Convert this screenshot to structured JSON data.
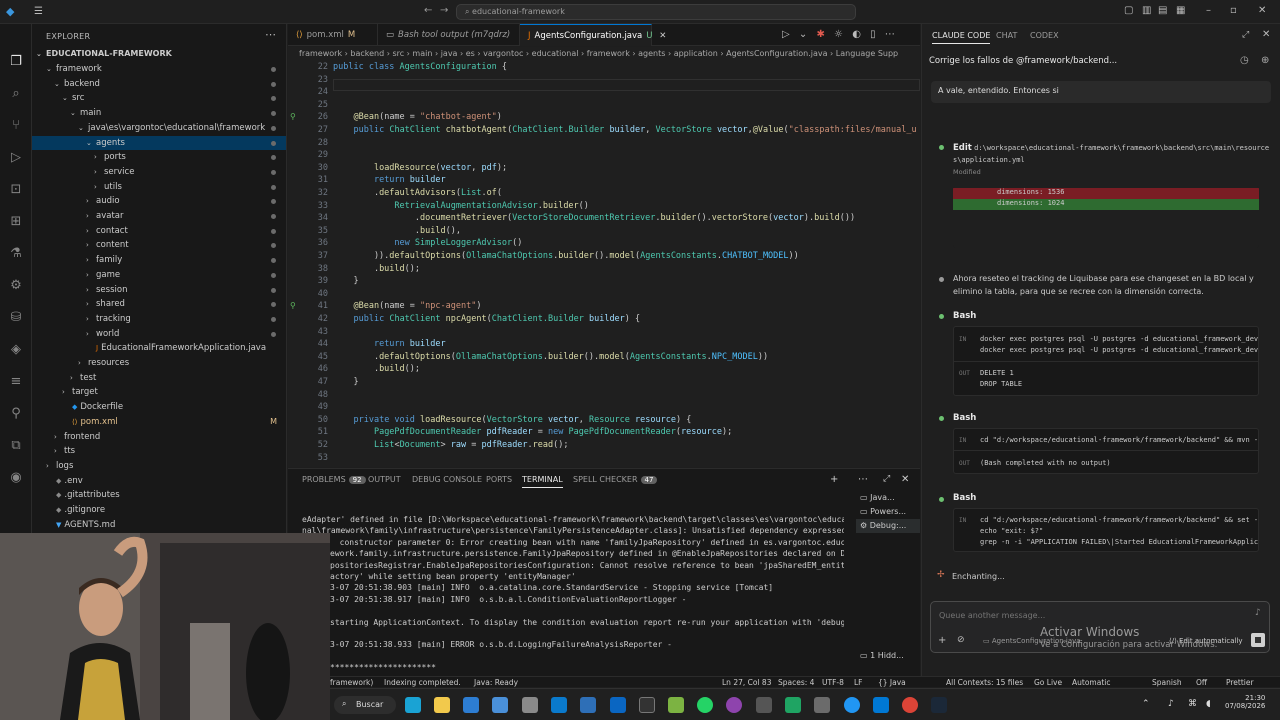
{
  "titlebar": {
    "search": "educational-framework",
    "menu_glyph": "☰"
  },
  "explorer": {
    "header": "EXPLORER",
    "root": "EDUCATIONAL-FRAMEWORK",
    "items": [
      {
        "label": "framework",
        "depth": 1,
        "type": "folder-open"
      },
      {
        "label": "backend",
        "depth": 2,
        "type": "folder-open"
      },
      {
        "label": "src",
        "depth": 3,
        "type": "folder-open"
      },
      {
        "label": "main",
        "depth": 4,
        "type": "folder-open"
      },
      {
        "label": "java\\es\\vargontoc\\educational\\framework",
        "depth": 5,
        "type": "folder-open"
      },
      {
        "label": "agents",
        "depth": 6,
        "type": "folder-open"
      },
      {
        "label": "ports",
        "depth": 7,
        "type": "folder"
      },
      {
        "label": "service",
        "depth": 7,
        "type": "folder"
      },
      {
        "label": "utils",
        "depth": 7,
        "type": "folder"
      },
      {
        "label": "audio",
        "depth": 6,
        "type": "folder"
      },
      {
        "label": "avatar",
        "depth": 6,
        "type": "folder"
      },
      {
        "label": "contact",
        "depth": 6,
        "type": "folder"
      },
      {
        "label": "content",
        "depth": 6,
        "type": "folder"
      },
      {
        "label": "family",
        "depth": 6,
        "type": "folder"
      },
      {
        "label": "game",
        "depth": 6,
        "type": "folder"
      },
      {
        "label": "session",
        "depth": 6,
        "type": "folder"
      },
      {
        "label": "shared",
        "depth": 6,
        "type": "folder"
      },
      {
        "label": "tracking",
        "depth": 6,
        "type": "folder"
      },
      {
        "label": "world",
        "depth": 6,
        "type": "folder"
      },
      {
        "label": "EducationalFrameworkApplication.java",
        "depth": 6,
        "type": "file"
      },
      {
        "label": "resources",
        "depth": 5,
        "type": "folder"
      },
      {
        "label": "test",
        "depth": 4,
        "type": "folder"
      },
      {
        "label": "target",
        "depth": 3,
        "type": "folder"
      },
      {
        "label": "Dockerfile",
        "depth": 3,
        "type": "file"
      },
      {
        "label": "pom.xml",
        "depth": 3,
        "type": "file",
        "flag": "M"
      },
      {
        "label": "frontend",
        "depth": 2,
        "type": "folder"
      },
      {
        "label": "tts",
        "depth": 2,
        "type": "folder"
      },
      {
        "label": "logs",
        "depth": 1,
        "type": "folder"
      },
      {
        "label": ".env",
        "depth": 1,
        "type": "file"
      },
      {
        "label": ".gitattributes",
        "depth": 1,
        "type": "file"
      },
      {
        "label": ".gitignore",
        "depth": 1,
        "type": "file"
      },
      {
        "label": "AGENTS.md",
        "depth": 1,
        "type": "file"
      },
      {
        "label": "docker-compose.yml",
        "depth": 1,
        "type": "file"
      }
    ]
  },
  "tabs": [
    {
      "label": "pom.xml",
      "flag": "M",
      "active": false
    },
    {
      "label": "Bash tool output (m7qdrz)",
      "flag": "",
      "active": false
    },
    {
      "label": "AgentsConfiguration.java",
      "flag": "U",
      "active": true
    }
  ],
  "breadcrumb": "framework › backend › src › main › java › es › vargontoc › educational › framework › agents › application › AgentsConfiguration.java › Language Supp",
  "code": {
    "lines": [
      {
        "n": "22",
        "html": "<span class='k'>public class</span> <span class='t'>AgentsConfiguration</span> {"
      },
      {
        "n": "23",
        "html": ""
      },
      {
        "n": "24",
        "html": ""
      },
      {
        "n": "25",
        "html": ""
      },
      {
        "n": "26",
        "html": "    <span class='a'>@Bean</span>(name = <span class='s'>\"chatbot-agent\"</span>)"
      },
      {
        "n": "27",
        "html": "    <span class='k'>public</span> <span class='t'>ChatClient</span> <span class='f'>chatbotAgent</span>(<span class='t'>ChatClient.Builder</span> <span class='p'>builder</span>, <span class='t'>VectorStore</span> <span class='p'>vector</span>,<span class='a'>@Value</span>(<span class='s'>\"classpath:files/manual_u</span>"
      },
      {
        "n": "28",
        "html": ""
      },
      {
        "n": "29",
        "html": ""
      },
      {
        "n": "30",
        "html": "        <span class='f'>loadResource</span>(<span class='p'>vector</span>, <span class='p'>pdf</span>);"
      },
      {
        "n": "31",
        "html": "        <span class='k'>return</span> <span class='p'>builder</span>"
      },
      {
        "n": "32",
        "html": "        .<span class='f'>defaultAdvisors</span>(<span class='t'>List</span>.<span class='f'>of</span>("
      },
      {
        "n": "33",
        "html": "            <span class='t'>RetrievalAugmentationAdvisor</span>.<span class='f'>builder</span>()"
      },
      {
        "n": "34",
        "html": "                .<span class='f'>documentRetriever</span>(<span class='t'>VectorStoreDocumentRetriever</span>.<span class='f'>builder</span>().<span class='f'>vectorStore</span>(<span class='p'>vector</span>).<span class='f'>build</span>())"
      },
      {
        "n": "35",
        "html": "                .<span class='f'>build</span>(),"
      },
      {
        "n": "36",
        "html": "            <span class='k'>new</span> <span class='t'>SimpleLoggerAdvisor</span>()"
      },
      {
        "n": "37",
        "html": "        )).<span class='f'>defaultOptions</span>(<span class='t'>OllamaChatOptions</span>.<span class='f'>builder</span>().<span class='f'>model</span>(<span class='t'>AgentsConstants</span>.<span class='c'>CHATBOT_MODEL</span>))"
      },
      {
        "n": "38",
        "html": "        .<span class='f'>build</span>();"
      },
      {
        "n": "39",
        "html": "    }"
      },
      {
        "n": "40",
        "html": ""
      },
      {
        "n": "41",
        "html": "    <span class='a'>@Bean</span>(name = <span class='s'>\"npc-agent\"</span>)"
      },
      {
        "n": "42",
        "html": "    <span class='k'>public</span> <span class='t'>ChatClient</span> <span class='f'>npcAgent</span>(<span class='t'>ChatClient.Builder</span> <span class='p'>builder</span>) {"
      },
      {
        "n": "43",
        "html": ""
      },
      {
        "n": "44",
        "html": "        <span class='k'>return</span> <span class='p'>builder</span>"
      },
      {
        "n": "45",
        "html": "        .<span class='f'>defaultOptions</span>(<span class='t'>OllamaChatOptions</span>.<span class='f'>builder</span>().<span class='f'>model</span>(<span class='t'>AgentsConstants</span>.<span class='c'>NPC_MODEL</span>))"
      },
      {
        "n": "46",
        "html": "        .<span class='f'>build</span>();"
      },
      {
        "n": "47",
        "html": "    }"
      },
      {
        "n": "48",
        "html": ""
      },
      {
        "n": "49",
        "html": ""
      },
      {
        "n": "50",
        "html": "    <span class='k'>private void</span> <span class='f'>loadResource</span>(<span class='t'>VectorStore</span> <span class='p'>vector</span>, <span class='t'>Resource</span> <span class='p'>resource</span>) {"
      },
      {
        "n": "51",
        "html": "        <span class='t'>PagePdfDocumentReader</span> <span class='p'>pdfReader</span> = <span class='k'>new</span> <span class='t'>PagePdfDocumentReader</span>(<span class='p'>resource</span>);"
      },
      {
        "n": "52",
        "html": "        <span class='t'>List</span>&lt;<span class='t'>Document</span>&gt; <span class='p'>raw</span> = <span class='p'>pdfReader</span>.<span class='f'>read</span>();"
      },
      {
        "n": "53",
        "html": ""
      }
    ]
  },
  "panel": {
    "tabs": [
      {
        "label": "PROBLEMS",
        "badge": "92"
      },
      {
        "label": "OUTPUT",
        "badge": ""
      },
      {
        "label": "DEBUG CONSOLE",
        "badge": ""
      },
      {
        "label": "PORTS",
        "badge": ""
      },
      {
        "label": "TERMINAL",
        "badge": ""
      },
      {
        "label": "SPELL CHECKER",
        "badge": "47"
      }
    ],
    "terminals": [
      "Java...",
      "Powers...",
      "Debug:...",
      "1 Hidd..."
    ],
    "terminal_lines": [
      "eAdapter' defined in file [D:\\Workspace\\educational-framework\\framework\\backend\\target\\classes\\es\\vargontoc\\educatio",
      "nal\\framework\\family\\infrastructure\\persistence\\FamilyPersistenceAdapter.class]: Unsatisfied dependency expressed th",
      "  constructor parameter 0: Error creating bean with name 'familyJpaRepository' defined in es.vargontoc.education",
      "ework.family.infrastructure.persistence.FamilyJpaRepository defined in @EnableJpaRepositories declared on Dat",
      "positoriesRegistrar.EnableJpaRepositoriesConfiguration: Cannot resolve reference to bean 'jpaSharedEM_entityMa",
      "actory' while setting bean property 'entityManager'",
      "3-07 20:51:38.903 [main] INFO  o.a.catalina.core.StandardService - Stopping service [Tomcat]",
      "3-07 20:51:38.917 [main] INFO  o.s.b.a.l.ConditionEvaluationReportLogger -",
      "",
      "starting ApplicationContext. To display the condition evaluation report re-run your application with 'debug' e",
      "",
      "3-07 20:51:38.933 [main] ERROR o.s.b.d.LoggingFailureAnalysisReporter -",
      "",
      "**********************"
    ]
  },
  "status": {
    "branch": "framework)",
    "indexing": "Indexing completed.",
    "java": "Java: Ready",
    "cursor": "Ln 27, Col 83",
    "spaces": "Spaces: 4",
    "encoding": "UTF-8",
    "eol": "LF",
    "lang": "{} Java",
    "files": "All Contexts: 15 files",
    "golive": "Go Live",
    "auto": "Automatic",
    "spell": "Spanish",
    "off": "Off",
    "prettier": "Prettier"
  },
  "claude": {
    "tabs": [
      "CLAUDE CODE",
      "CHAT",
      "CODEX"
    ],
    "conversation_title": "Corrige los fallos de @framework/backend...",
    "user_message": "A vale, entendido. Entonces si",
    "edit": {
      "label": "Edit",
      "path": "d:\\workspace\\educational-framework\\framework\\backend\\src\\main\\resource",
      "path2": "s\\application.yml",
      "status": "Modified",
      "removed": "dimensions: 1536",
      "added": "dimensions: 1024"
    },
    "explain": "Ahora reseteo el tracking de Liquibase para ese changeset en la BD local y elimino la tabla, para que se recree con la dimensión correcta.",
    "bash1": {
      "label": "Bash",
      "in1": "docker exec postgres psql -U postgres -d educational_framework_dev",
      "in2": "docker exec postgres psql -U postgres -d educational_framework_dev",
      "out1": "DELETE 1",
      "out2": "DROP TABLE"
    },
    "bash2": {
      "label": "Bash",
      "in": "cd \"d:/workspace/educational-framework/framework/backend\" && mvn -q",
      "out": "(Bash completed with no output)"
    },
    "bash3": {
      "label": "Bash",
      "in1": "cd \"d:/workspace/educational-framework/framework/backend\" && set -a",
      "in2": "echo \"exit: $?\"",
      "in3": "grep -n -i \"APPLICATION FAILED\\|Started EducationalFrameworkApplicat"
    },
    "status": "Enchanting...",
    "input_placeholder": "Queue another message...",
    "attachment": "AgentsConfiguration.java",
    "mode": "Edit automatically"
  },
  "watermark": {
    "line1": "Activar Windows",
    "line2": "Ve a Configuración para activar Windows."
  },
  "taskbar": {
    "search": "Buscar",
    "time": "21:30",
    "date": "07/08/2026"
  },
  "colors": {
    "accent": "#0078d4",
    "added_bg": "#2e6b30",
    "removed_bg": "#7a1d24"
  }
}
